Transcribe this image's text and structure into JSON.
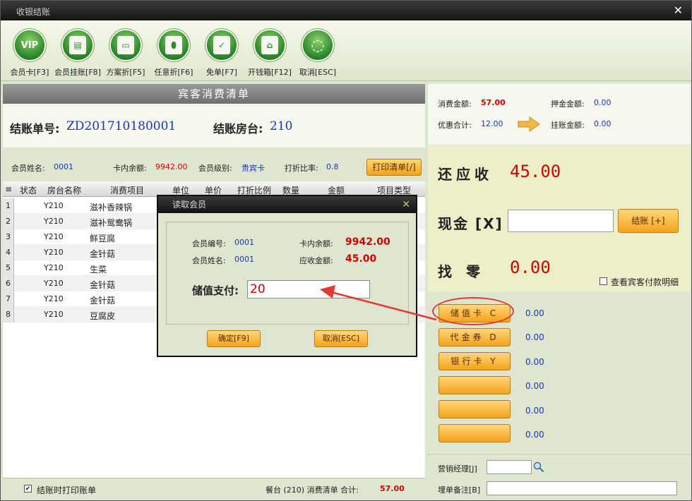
{
  "window": {
    "title": "收银结账",
    "close_glyph": "✕"
  },
  "toolbar": [
    {
      "label": "会员卡[F3]",
      "icon": "vip-card-icon",
      "glyph": "VIP"
    },
    {
      "label": "会员挂账[F8]",
      "icon": "member-credit-icon",
      "glyph": "▤"
    },
    {
      "label": "方案折[F5]",
      "icon": "plan-discount-icon",
      "glyph": "▭"
    },
    {
      "label": "任意折[F6]",
      "icon": "custom-discount-icon",
      "glyph": "⬮"
    },
    {
      "label": "免单[F7]",
      "icon": "free-bill-icon",
      "glyph": "✓"
    },
    {
      "label": "开钱箱[F12]",
      "icon": "cash-drawer-icon",
      "glyph": "⌂"
    },
    {
      "label": "取消[ESC]",
      "icon": "cancel-icon",
      "glyph": "◌"
    }
  ],
  "bill": {
    "header": "宾客消费清单",
    "no_label": "结账单号:",
    "no_value": "ZD201710180001",
    "room_label": "结账房台:",
    "room_value": "210"
  },
  "member": {
    "name_label": "会员姓名:",
    "name_value": "0001",
    "balance_label": "卡内余额:",
    "balance_value": "9942.00",
    "level_label": "会员级别:",
    "level_value": "贵宾卡",
    "rate_label": "打折比率:",
    "rate_value": "0.8",
    "print_btn": "打印清单[/]"
  },
  "grid": {
    "columns": [
      "≡",
      "状态",
      "房台名称",
      "消费项目",
      "单位",
      "单价",
      "打折比例",
      "数量",
      "金额",
      "项目类型"
    ],
    "rows": [
      {
        "n": "1",
        "room": "Y210",
        "item": "滋补香辣锅"
      },
      {
        "n": "2",
        "room": "Y210",
        "item": "滋补鸳鸯锅"
      },
      {
        "n": "3",
        "room": "Y210",
        "item": "鲜豆腐"
      },
      {
        "n": "4",
        "room": "Y210",
        "item": "金针菇"
      },
      {
        "n": "5",
        "room": "Y210",
        "item": "生菜"
      },
      {
        "n": "6",
        "room": "Y210",
        "item": "金针菇"
      },
      {
        "n": "7",
        "room": "Y210",
        "item": "金针菇"
      },
      {
        "n": "8",
        "room": "Y210",
        "item": "豆腐皮"
      }
    ]
  },
  "footer": {
    "print_on_checkout": "结账时打印账单",
    "check_glyph": "✔",
    "summary": "餐台 (210) 消费清单 合计:",
    "total": "57.00"
  },
  "summary": {
    "consume_label": "消费金额:",
    "consume_value": "57.00",
    "deposit_label": "押金金额:",
    "deposit_value": "0.00",
    "discount_label": "优惠合计:",
    "discount_value": "12.00",
    "credit_label": "挂账金额:",
    "credit_value": "0.00"
  },
  "payment": {
    "due_label": "还应收",
    "due_value": "45.00",
    "cash_label": "现金 [X]",
    "checkout_btn": "结账 [+]",
    "change_label": "找零",
    "change_value": "0.00",
    "view_detail": "查看宾客付款明细"
  },
  "methods": [
    {
      "label": "储值卡 C",
      "value": "0.00"
    },
    {
      "label": "代金券 D",
      "value": "0.00"
    },
    {
      "label": "银行卡 Y",
      "value": "0.00"
    },
    {
      "label": "",
      "value": "0.00"
    },
    {
      "label": "",
      "value": "0.00"
    },
    {
      "label": "",
      "value": "0.00"
    }
  ],
  "extra": {
    "manager_label": "营销经理[J]",
    "note_label": "埋单备注[B]"
  },
  "dialog": {
    "title": "读取会员",
    "no_label": "会员编号:",
    "no_value": "0001",
    "name_label": "会员姓名:",
    "name_value": "0001",
    "balance_label": "卡内余额:",
    "balance_value": "9942.00",
    "due_label": "应收金额:",
    "due_value": "45.00",
    "pay_label": "储值支付:",
    "pay_value": "20",
    "ok_btn": "确定[F9]",
    "cancel_btn": "取消[ESC]"
  },
  "colors": {
    "accent_red": "#d00000",
    "value_blue": "#1a37b5",
    "button_orange": "#f4a21b",
    "highlight_circle": "#e53935"
  }
}
